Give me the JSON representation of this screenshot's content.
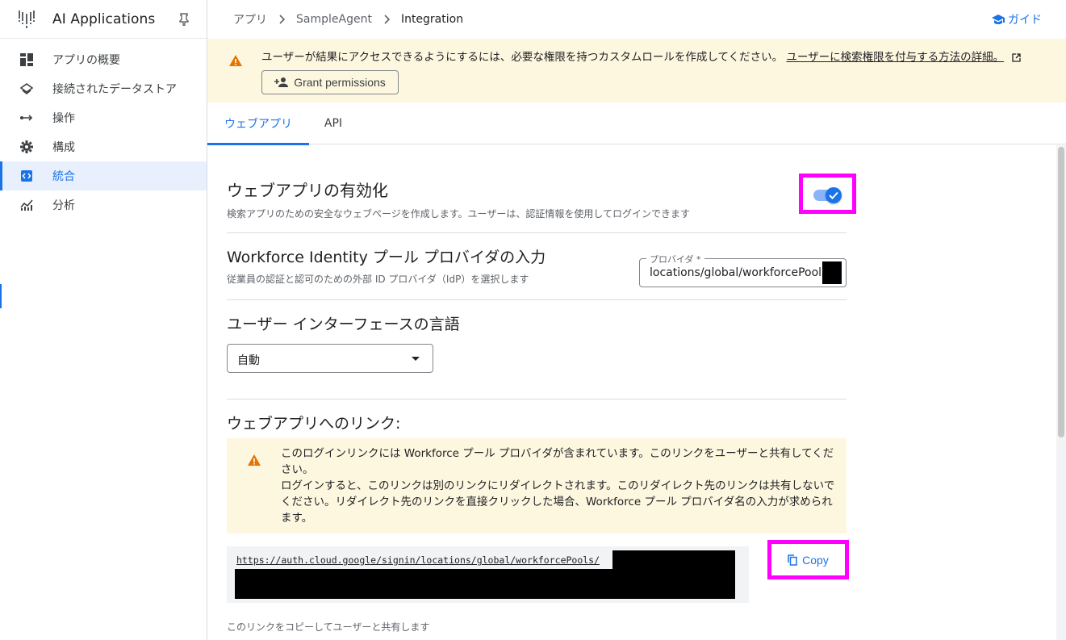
{
  "app": {
    "title": "AI Applications"
  },
  "sidebar": {
    "items": [
      {
        "label": "アプリの概要",
        "icon": "dashboard-icon",
        "active": false
      },
      {
        "label": "接続されたデータストア",
        "icon": "layers-icon",
        "active": false
      },
      {
        "label": "操作",
        "icon": "actions-icon",
        "active": false
      },
      {
        "label": "構成",
        "icon": "gear-icon",
        "active": false
      },
      {
        "label": "統合",
        "icon": "code-icon",
        "active": true
      },
      {
        "label": "分析",
        "icon": "analytics-icon",
        "active": false
      }
    ]
  },
  "breadcrumb": {
    "items": [
      "アプリ",
      "SampleAgent",
      "Integration"
    ]
  },
  "header": {
    "guide_label": "ガイド"
  },
  "banner": {
    "text": "ユーザーが結果にアクセスできるようにするには、必要な権限を持つカスタムロールを作成してください。",
    "link": "ユーザーに検索権限を付与する方法の詳細。",
    "button": "Grant permissions"
  },
  "tabs": [
    {
      "label": "ウェブアプリ",
      "active": true
    },
    {
      "label": "API",
      "active": false
    }
  ],
  "webapp": {
    "enable_title": "ウェブアプリの有効化",
    "enable_sub": "検索アプリのための安全なウェブページを作成します。ユーザーは、認証情報を使用してログインできます",
    "enabled": true,
    "wif_title": "Workforce Identity プール プロバイダの入力",
    "wif_sub": "従業員の認証と認可のための外部 ID プロバイダ（IdP）を選択します",
    "provider_label": "プロバイダ *",
    "provider_value": "locations/global/workforcePools/",
    "lang_title": "ユーザー インターフェースの言語",
    "lang_value": "自動",
    "link_title": "ウェブアプリへのリンク:",
    "note_lines": [
      "このログインリンクには Workforce プール プロバイダが含まれています。このリンクをユーザーと共有してください。",
      "ログインすると、このリンクは別のリンクにリダイレクトされます。このリダイレクト先のリンクは共有しないでください。リダイレクト先のリンクを直接クリックした場合、Workforce プール プロバイダ名の入力が求められます。"
    ],
    "link_url": "https://auth.cloud.google/signin/locations/global/workforcePools/",
    "copy_label": "Copy",
    "helper": "このリンクをコピーしてユーザーと共有します"
  },
  "colors": {
    "accent": "#1a73e8",
    "warning": "#e37400",
    "banner_bg": "#fef7e0",
    "highlight": "#ff00ff"
  }
}
